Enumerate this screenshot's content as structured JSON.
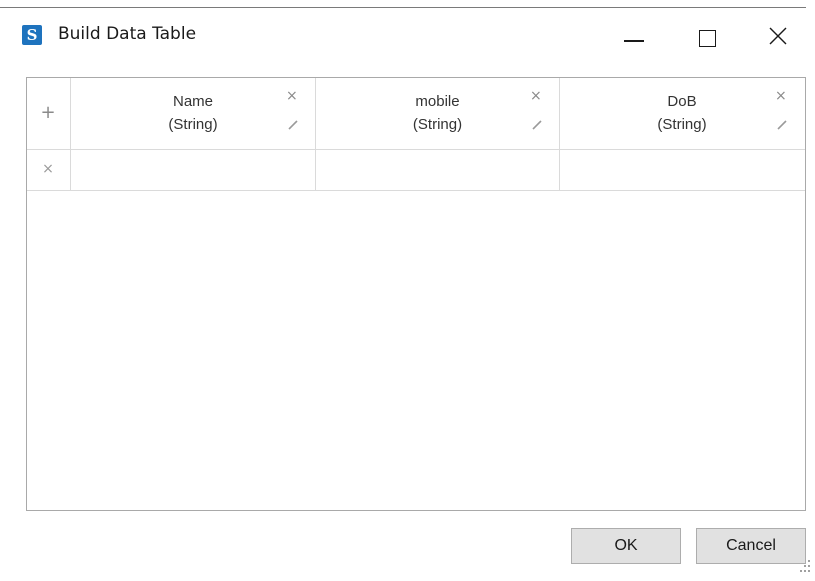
{
  "window": {
    "title": "Build Data Table",
    "icon": "app-logo-s",
    "icon_letter": "S",
    "accent_color": "#1e73be",
    "controls": [
      "minimize",
      "maximize",
      "close"
    ]
  },
  "table": {
    "add_column_icon": "+",
    "columns": [
      {
        "name": "Name",
        "type": "(String)"
      },
      {
        "name": "mobile",
        "type": "(String)"
      },
      {
        "name": "DoB",
        "type": "(String)"
      }
    ],
    "rows": [
      {
        "cells": [
          "",
          "",
          ""
        ]
      }
    ]
  },
  "icons": {
    "remove": "×"
  },
  "buttons": {
    "ok": "OK",
    "cancel": "Cancel"
  }
}
